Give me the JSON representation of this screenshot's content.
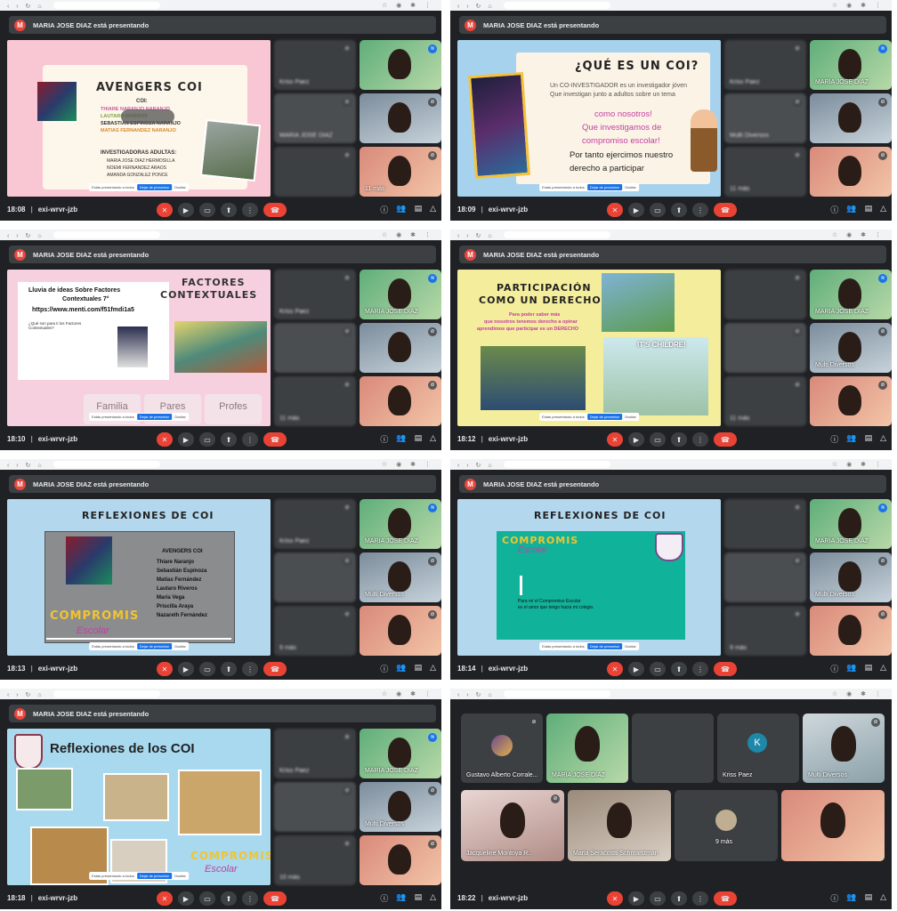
{
  "banner_text": "MARIA JOSE DIAZ está presentando",
  "banner_initial": "M",
  "meeting_code": "exi-wrvr-jzb",
  "panels": [
    {
      "time": "18:08",
      "slide": {
        "title": "AVENGERS COI",
        "coi_label": "COI:",
        "coi_names": [
          "THIARE NARANJO NARANJO",
          "LAUTARO RIVEROS",
          "SEBASTIAN ESPINOZA NARANJO",
          "MATIAS FERNANDEZ NARANJO"
        ],
        "adults_label": "INVESTIGADORAS ADULTAS:",
        "adults": [
          "MARIA JOSE DIAZ HERMOSILLA",
          "NOEMI FERNANDEZ ARAOS",
          "AMANDA GONZALEZ PONCE"
        ]
      },
      "tiles": [
        "Kriss Paez",
        "",
        "MARIA JOSE DIAZ",
        "",
        "",
        "11 más"
      ]
    },
    {
      "time": "18:09",
      "slide": {
        "title": "¿QUÉ ES UN COI?",
        "lines": [
          "Un CO-INVESTIGADOR es un investigador jóven",
          "Que investigan junto a adultos sobre un tema"
        ],
        "pink_lines": [
          "como nosotros!",
          "Que investigamos de",
          "compromiso escolar!"
        ],
        "dark_lines": [
          "Por tanto ejercimos nuestro",
          "derecho a participar"
        ]
      },
      "tiles": [
        "Kriss Paez",
        "MARIA JOSE DIAZ",
        "Multi Diversos",
        "",
        "11 más",
        ""
      ]
    },
    {
      "time": "18:10",
      "slide": {
        "title_line1": "FACTORES",
        "title_line2": "CONTEXTUALES",
        "heading1": "Lluvia de ideas Sobre Factores",
        "heading2": "Contextuales 7°",
        "url": "https://www.menti.com/f51fmdi1a5",
        "question": "¿Qué son para ti los Factores Contextuales?",
        "buttons": [
          "Familia",
          "Pares",
          "Profes"
        ]
      },
      "tiles": [
        "Kriss Paez",
        "MARIA JOSE DIAZ",
        "",
        "",
        "11 más",
        ""
      ]
    },
    {
      "time": "18:12",
      "slide": {
        "title_line1": "PARTICIPACIÓN",
        "title_line2": "COMO UN DERECHO",
        "sub1": "Para poder saber más",
        "sub2": "que nosotros tenemos derecho a opinar",
        "sub3": "aprendimos que participar es un DERECHO",
        "cartoon": "IT'S CHILDRE!"
      },
      "tiles": [
        "",
        "MARIA JOSE DIAZ",
        "",
        "Multi Diversos",
        "11 más",
        ""
      ]
    },
    {
      "time": "18:13",
      "slide": {
        "title": "REFLEXIONES DE COI",
        "group": "AVENGERS COI",
        "members": [
          "Thiare Naranjo",
          "Sebastián Espinoza",
          "Matías Fernández",
          "Lautaro Riveros",
          "María Vega",
          "Priscilla Araya",
          "Nazareth Fernández"
        ],
        "logo1": "COMPROMIS",
        "logo2": "Escolar"
      },
      "tiles": [
        "Kriss Paez",
        "MARIA JOSE DIAZ",
        "",
        "Multi Diversos",
        "9 más",
        ""
      ]
    },
    {
      "time": "18:14",
      "slide": {
        "title": "REFLEXIONES DE COI",
        "logo1": "COMPROMIS",
        "logo2": "Escolar",
        "caption1": "Para mí el Compromiso Escolar",
        "caption2": "es el amor que tengo hacia mi colegio."
      },
      "tiles": [
        "",
        "MARIA JOSE DIAZ",
        "",
        "Multi Diversos",
        "9 más",
        ""
      ]
    },
    {
      "time": "18:18",
      "slide": {
        "title": "Reflexiones  de los COI",
        "logo1": "COMPROMIS",
        "logo2": "Escolar"
      },
      "tiles": [
        "Kriss Paez",
        "MARIA JOSE DIAZ",
        "",
        "Multi Diversos",
        "10 más",
        ""
      ]
    },
    {
      "time": "18:22",
      "grid": [
        "Gustavo Alberto Corrale...",
        "MARIA JOSE DIAZ",
        "",
        "Kriss Paez",
        "Multi Diversos",
        "Jacqueline Montoya R...",
        "Maria Seracostti Schmartzman",
        "9 más",
        ""
      ]
    }
  ],
  "presenting_bar": {
    "label": "Estás presentando a todos",
    "stop": "Dejar de presentar",
    "hide": "Ocultar"
  },
  "colors": {
    "meet_bg": "#202124",
    "end_call": "#ea4335",
    "accent": "#1a73e8"
  }
}
